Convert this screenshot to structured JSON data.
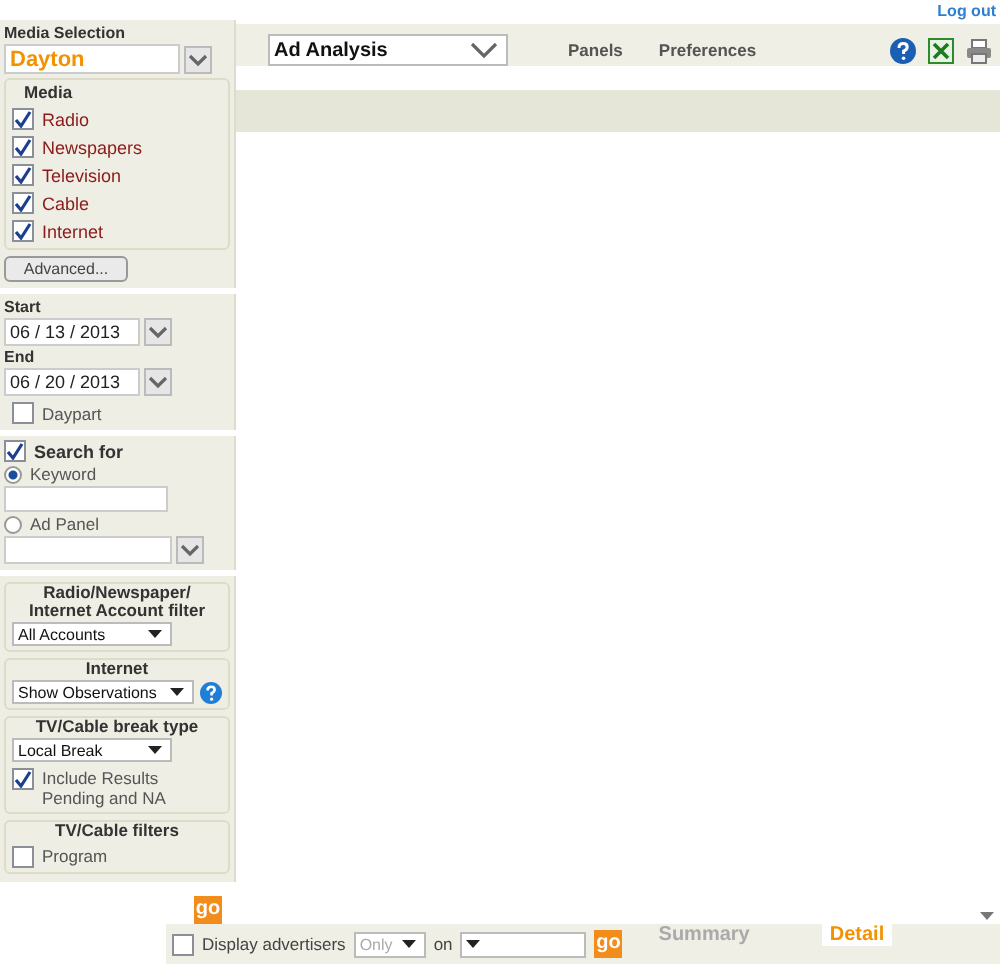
{
  "header": {
    "logout": "Log out",
    "module": "Ad Analysis",
    "nav": [
      "Panels",
      "Preferences"
    ]
  },
  "sidebar": {
    "media_selection": {
      "label": "Media Selection",
      "value": "Dayton"
    },
    "media": {
      "title": "Media",
      "items": [
        {
          "label": "Radio",
          "checked": true
        },
        {
          "label": "Newspapers",
          "checked": true
        },
        {
          "label": "Television",
          "checked": true
        },
        {
          "label": "Cable",
          "checked": true
        },
        {
          "label": "Internet",
          "checked": true
        }
      ]
    },
    "advanced": "Advanced...",
    "dates": [
      {
        "label": "Start",
        "value": "06 / 13 / 2013"
      },
      {
        "label": "End",
        "value": "06 / 20 / 2013"
      }
    ],
    "daypart": {
      "label": "Daypart",
      "checked": false
    },
    "search": {
      "label": "Search for",
      "checked": true,
      "options": [
        {
          "label": "Keyword",
          "selected": true,
          "kind": "text"
        },
        {
          "label": "Ad Panel",
          "selected": false,
          "kind": "combo"
        }
      ]
    },
    "filters": [
      {
        "title": "Radio/Newspaper/ Internet Account filter",
        "controls": [
          {
            "kind": "select",
            "value": "All Accounts"
          }
        ]
      },
      {
        "title": "Internet",
        "controls": [
          {
            "kind": "select",
            "value": "Show Observations"
          },
          {
            "kind": "help"
          }
        ]
      },
      {
        "title": "TV/Cable break type",
        "controls": [
          {
            "kind": "select",
            "value": "Local Break"
          },
          {
            "kind": "checkbox",
            "label": "Include Results Pending and NA",
            "checked": true
          }
        ]
      },
      {
        "title": "TV/Cable filters",
        "controls": [
          {
            "kind": "checkbox",
            "label": "Program",
            "checked": false
          }
        ]
      }
    ],
    "go": "go"
  },
  "bottom": {
    "display": {
      "label": "Display advertisers",
      "checked": false
    },
    "mode": "Only",
    "on": "on",
    "go": "go",
    "tabs": [
      {
        "label": "Summary",
        "selected": false
      },
      {
        "label": "Detail",
        "selected": true
      }
    ]
  }
}
